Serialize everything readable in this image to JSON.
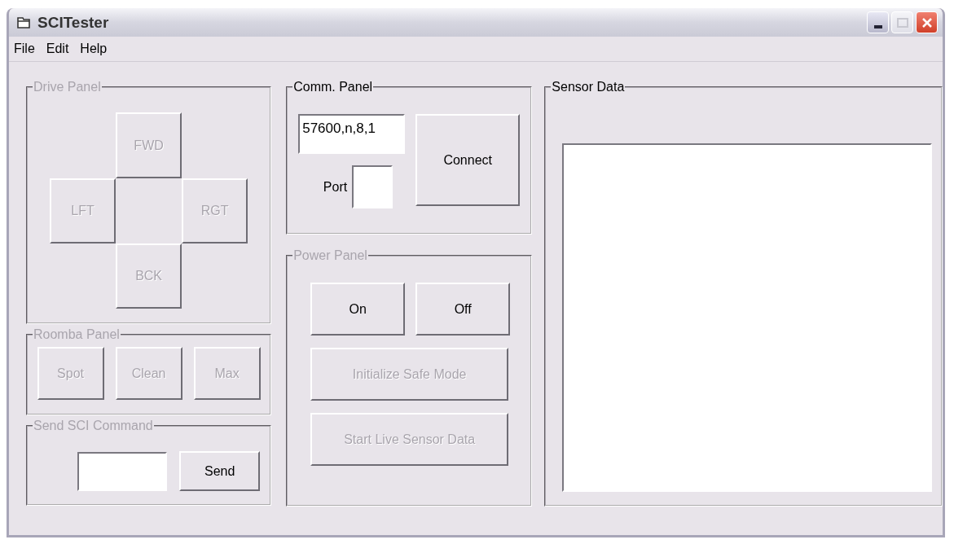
{
  "window": {
    "title": "SCITester"
  },
  "menu": [
    "File",
    "Edit",
    "Help"
  ],
  "drive_panel": {
    "title": "Drive Panel",
    "disabled": true,
    "buttons": [
      {
        "label": "FWD",
        "disabled": true
      },
      {
        "label": "LFT",
        "disabled": true
      },
      {
        "label": "RGT",
        "disabled": true
      },
      {
        "label": "BCK",
        "disabled": true
      }
    ]
  },
  "roomba_panel": {
    "title": "Roomba Panel",
    "disabled": true,
    "buttons": [
      {
        "label": "Spot",
        "disabled": true
      },
      {
        "label": "Clean",
        "disabled": true
      },
      {
        "label": "Max",
        "disabled": true
      }
    ]
  },
  "send_panel": {
    "title": "Send SCI Command",
    "disabled": true,
    "send_button": {
      "label": "Send",
      "disabled": false
    }
  },
  "comm_panel": {
    "title": "Comm. Panel",
    "disabled": false,
    "settings_value": "57600,n,8,1",
    "port_label": "Port",
    "connect_button": {
      "label": "Connect",
      "disabled": false
    }
  },
  "power_panel": {
    "title": "Power Panel",
    "disabled": true,
    "buttons": [
      {
        "label": "On",
        "kind": "half",
        "disabled": false
      },
      {
        "label": "Off",
        "kind": "half",
        "disabled": false
      },
      {
        "label": "Initialize Safe Mode",
        "kind": "wide",
        "disabled": true
      },
      {
        "label": "Start Live Sensor Data",
        "kind": "wide",
        "disabled": true
      }
    ]
  },
  "sensor_panel": {
    "title": "Sensor Data",
    "disabled": false
  }
}
